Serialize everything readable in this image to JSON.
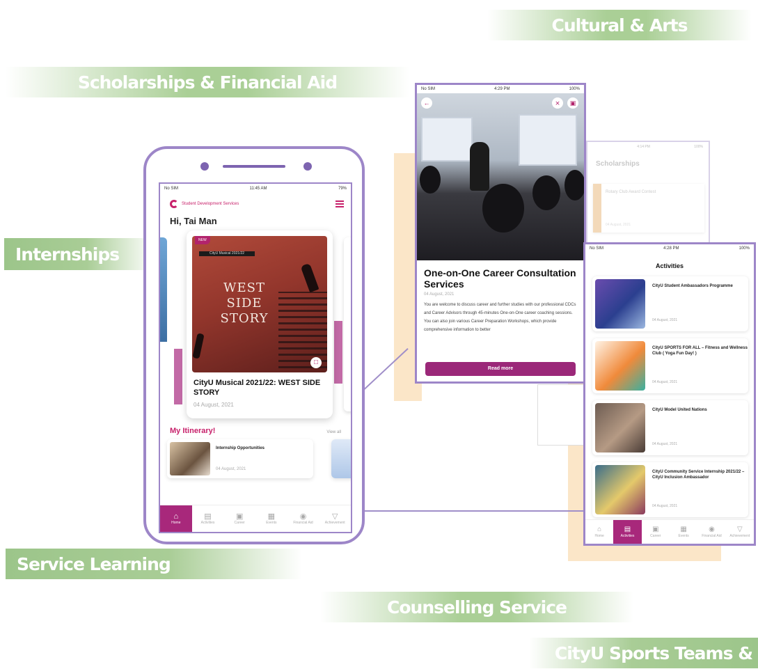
{
  "banners": {
    "cultural": "Cultural & Arts",
    "scholarships": "Scholarships & Financial Aid",
    "internships": "Internships",
    "service_learning": "Service Learning",
    "counselling": "Counselling Service",
    "sports": "CityU Sports Teams &"
  },
  "main_phone": {
    "status": {
      "left": "No SIM",
      "time": "11:45 AM",
      "right": "79%"
    },
    "logo_text": "Student Development Services",
    "greeting": "Hi, Tai Man",
    "featured": {
      "new_tag": "NEW",
      "poster_band": "CityU Musical 2021/22",
      "poster_title": "WEST SIDE STORY",
      "title": "CityU Musical 2021/22: WEST SIDE STORY",
      "date": "04 August, 2021"
    },
    "itinerary": {
      "title": "My Itinerary!",
      "view_all": "View all",
      "item_title": "Internship Opportunities",
      "item_date": "04 August, 2021"
    },
    "tabs": [
      {
        "label": "Home",
        "icon": "home-icon"
      },
      {
        "label": "Activities",
        "icon": "ticket-icon"
      },
      {
        "label": "Career",
        "icon": "briefcase-icon"
      },
      {
        "label": "Events",
        "icon": "calendar-icon"
      },
      {
        "label": "Financial Aid",
        "icon": "money-icon"
      },
      {
        "label": "Achievement",
        "icon": "trophy-icon"
      }
    ]
  },
  "detail_screen": {
    "status": {
      "left": "No SIM",
      "time": "4:29 PM",
      "right": "100%"
    },
    "title": "One-on-One Career Consultation Services",
    "date": "04 August, 2021",
    "body": "You are welcome to discuss career and further studies with our professional CDCs and Career Advisors through 45-minutes One-on-One career coaching sessions. You can also join various Career Preparation Workshops, which provide comprehensive information to better",
    "read_more": "Read more"
  },
  "scholarship_screen": {
    "status_time": "4:14 PM",
    "status_right": "100%",
    "title": "Scholarships",
    "item_title": "Rotary Club Award Contest",
    "item_date": "04 August, 2021"
  },
  "activities_screen": {
    "status": {
      "left": "No SIM",
      "time": "4:28 PM",
      "right": "100%"
    },
    "title": "Activities",
    "items": [
      {
        "title": "CityU Student Ambassadors Programme",
        "date": "04 August, 2021"
      },
      {
        "title": "CityU SPORTS FOR ALL – Fitness and Wellness Club ( Yoga Fun Day! )",
        "date": "04 August, 2021"
      },
      {
        "title": "CityU Model United Nations",
        "date": "04 August, 2021"
      },
      {
        "title": "CityU Community Service Internship 2021/22 – CityU Inclusion Ambassador",
        "date": "04 August, 2021"
      }
    ],
    "tabs": [
      "Home",
      "Activities",
      "Career",
      "Events",
      "Financial Aid",
      "Achievement"
    ]
  }
}
